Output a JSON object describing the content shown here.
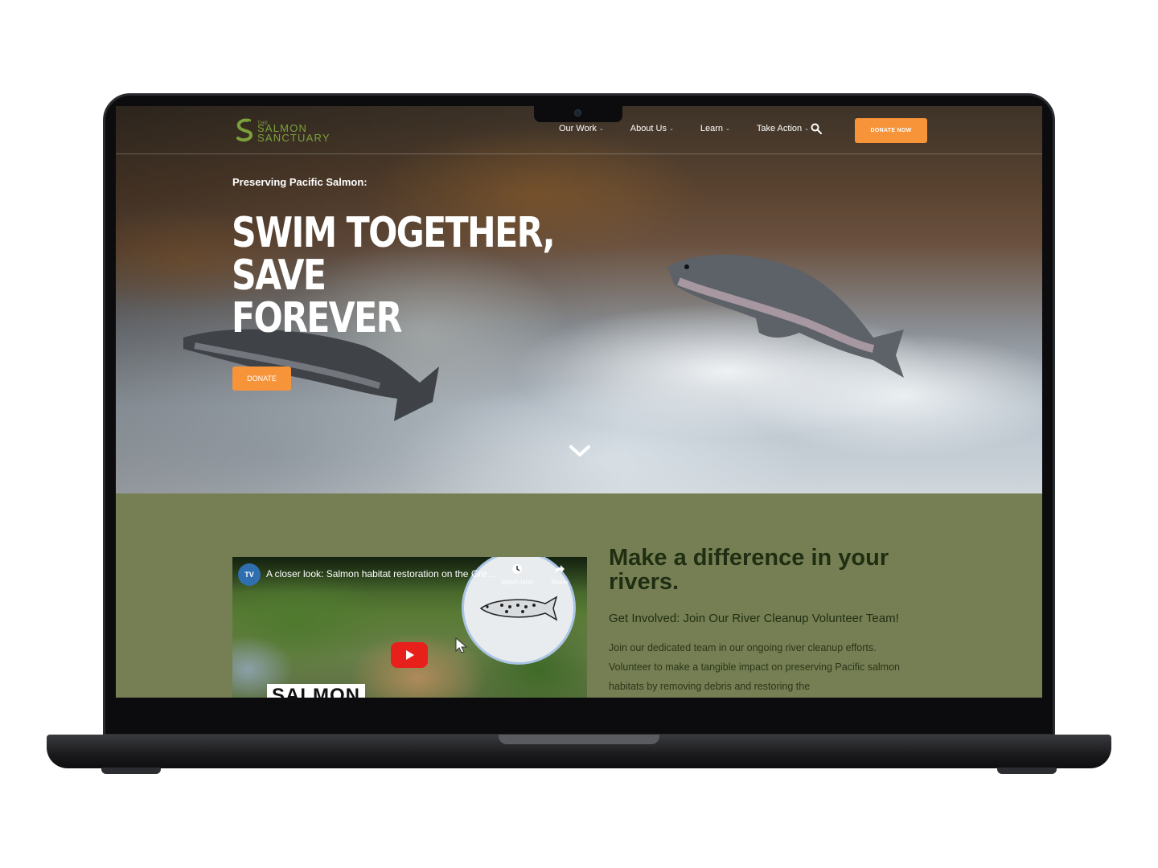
{
  "site": {
    "logo": {
      "small": "THE",
      "line1": "SALMON",
      "line2": "SANCTUARY"
    },
    "nav": {
      "items": [
        {
          "label": "Our Work"
        },
        {
          "label": "About Us"
        },
        {
          "label": "Learn"
        },
        {
          "label": "Take Action"
        }
      ],
      "donate_label": "DONATE NOW"
    },
    "hero": {
      "eyebrow": "Preserving Pacific Salmon:",
      "headline_line1": "SWIM TOGETHER,",
      "headline_line2": "SAVE",
      "headline_line3": "FOREVER",
      "donate_label": "DONATE"
    },
    "video": {
      "channel": "TV",
      "title": "A closer look: Salmon habitat restoration on the Gre...",
      "watch_later": "Watch later",
      "share": "Share",
      "caption": "SALMON"
    },
    "involve": {
      "title": "Make a difference in your rivers.",
      "subtitle": "Get Involved: Join Our River Cleanup Volunteer Team!",
      "body": "Join our dedicated team in our ongoing river cleanup efforts. Volunteer to make a tangible impact on preserving Pacific salmon habitats by removing debris and restoring the"
    }
  },
  "colors": {
    "accent": "#f7943a",
    "section_bg": "#767f53",
    "logo_green": "#7aa13a",
    "heading_dark": "#1f2e12"
  }
}
